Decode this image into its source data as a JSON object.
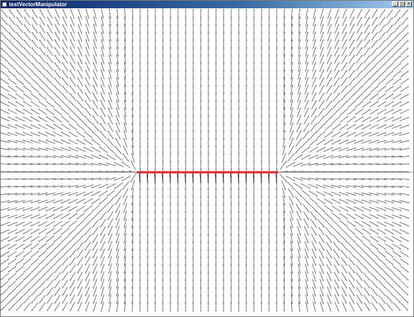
{
  "window": {
    "title": "testVectorManipulator",
    "controls": {
      "minimize_icon": "_",
      "maximize_icon": "□",
      "close_icon": "×"
    }
  },
  "canvas": {
    "background": "#ffffff",
    "vector_color": "#555555",
    "axis_color": "#999999",
    "segment_color": "#e02020",
    "icons": [
      "app-icon",
      "minimize-icon",
      "maximize-icon",
      "close-icon"
    ]
  }
}
